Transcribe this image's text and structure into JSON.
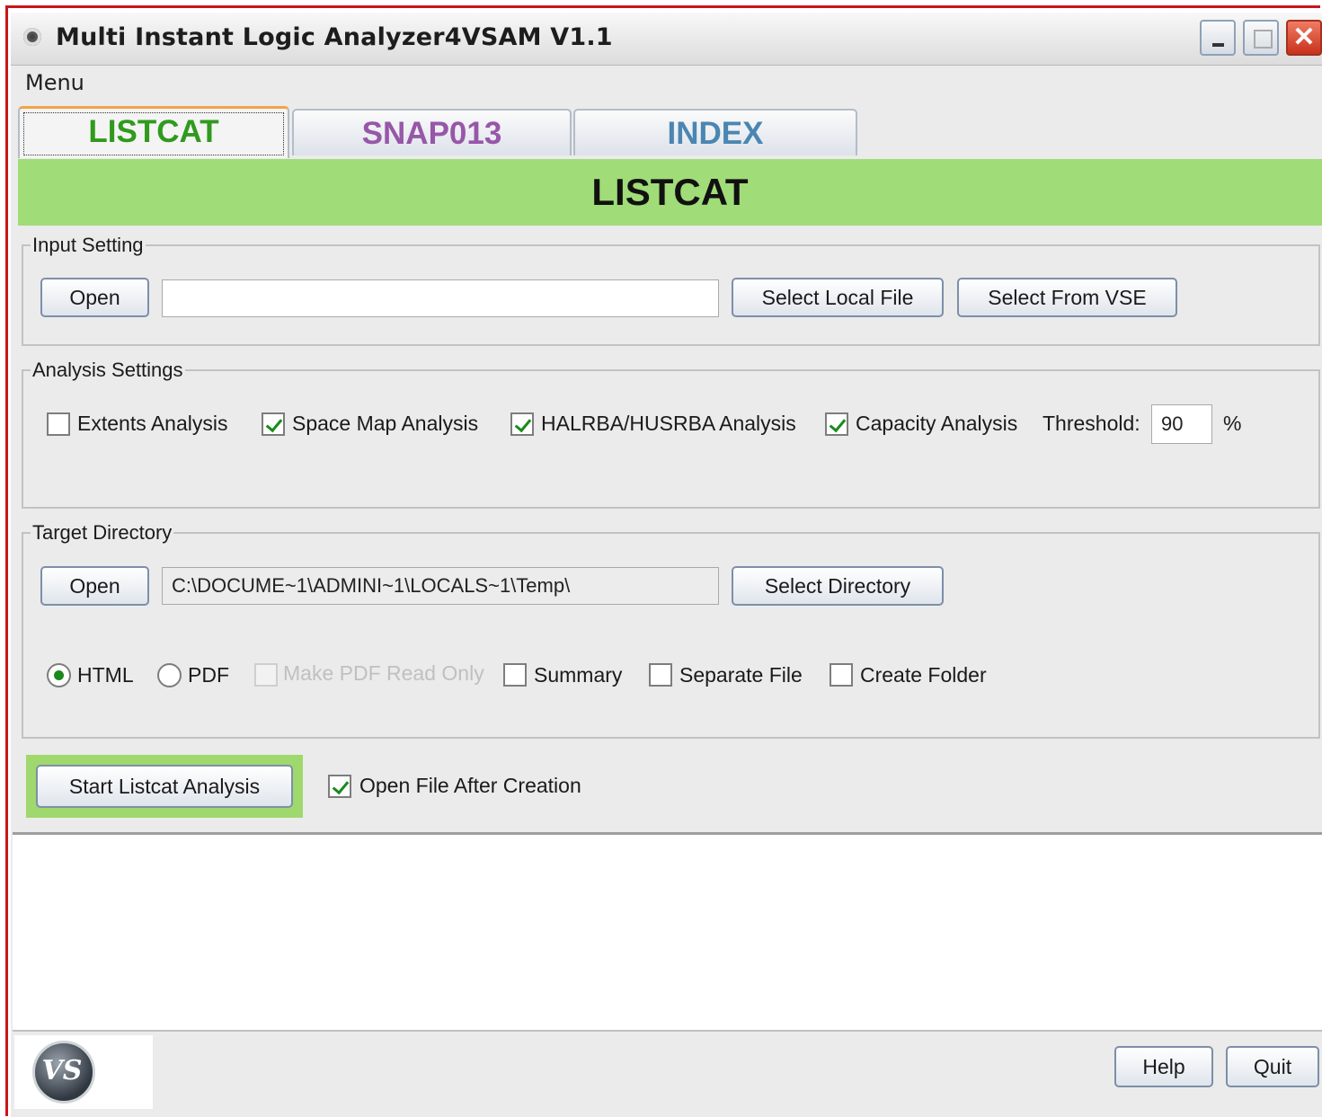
{
  "window": {
    "title": "Multi Instant Logic Analyzer4VSAM V1.1"
  },
  "menubar": {
    "menu_label": "Menu"
  },
  "tabs": [
    {
      "label": "LISTCAT",
      "active": true
    },
    {
      "label": "SNAP013",
      "active": false
    },
    {
      "label": "INDEX",
      "active": false
    }
  ],
  "banner": {
    "title": "LISTCAT"
  },
  "input_setting": {
    "legend": "Input Setting",
    "open_label": "Open",
    "file_value": "",
    "select_local_label": "Select Local File",
    "select_vse_label": "Select From VSE"
  },
  "analysis_settings": {
    "legend": "Analysis Settings",
    "extents_label": "Extents Analysis",
    "extents_checked": false,
    "space_map_label": "Space Map Analysis",
    "space_map_checked": true,
    "halrba_label": "HALRBA/HUSRBA Analysis",
    "halrba_checked": true,
    "capacity_label": "Capacity Analysis",
    "capacity_checked": true,
    "threshold_label": "Threshold:",
    "threshold_value": "90",
    "percent_label": "%"
  },
  "target_directory": {
    "legend": "Target Directory",
    "open_label": "Open",
    "path_value": "C:\\DOCUME~1\\ADMINI~1\\LOCALS~1\\Temp\\",
    "select_dir_label": "Select Directory",
    "html_label": "HTML",
    "pdf_label": "PDF",
    "format_selected": "HTML",
    "make_pdf_ro_label": "Make PDF Read Only",
    "summary_label": "Summary",
    "separate_file_label": "Separate File",
    "create_folder_label": "Create Folder"
  },
  "actions": {
    "start_label": "Start Listcat Analysis",
    "open_after_label": "Open File After Creation",
    "open_after_checked": true
  },
  "footer": {
    "logo_text": "VS",
    "help_label": "Help",
    "quit_label": "Quit"
  },
  "colors": {
    "banner": "#a0dc78",
    "tab_listcat": "#2f9a1e",
    "tab_snap013": "#9757a8",
    "tab_index": "#4a86b2",
    "frame": "#c8151b"
  }
}
